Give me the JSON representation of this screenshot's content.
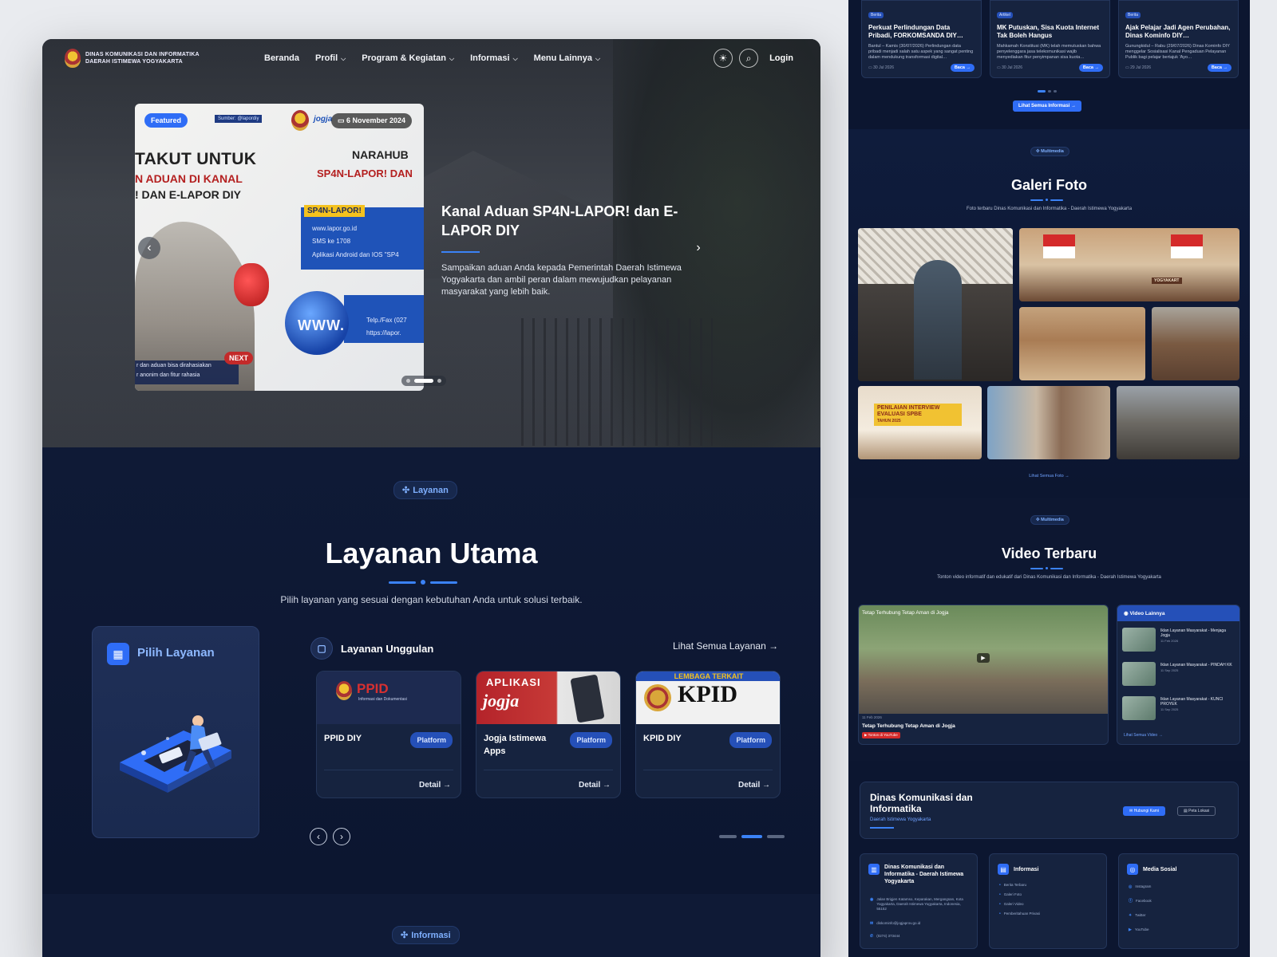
{
  "nav": {
    "logo_line1": "DINAS KOMUNIKASI DAN INFORMATIKA",
    "logo_line2": "DAERAH ISTIMEWA YOGYAKARTA",
    "items": [
      "Beranda",
      "Profil",
      "Program & Kegiatan",
      "Informasi",
      "Menu Lainnya"
    ],
    "login": "Login"
  },
  "hero": {
    "featured": "Featured",
    "sumber": "Sumber: @lapordiy",
    "logo_text": "jogja",
    "date": "6 November 2024",
    "poster_line1": "TAKUT UNTUK",
    "poster_line2": "N ADUAN DI KANAL",
    "poster_line3": "!  DAN E-LAPOR DIY",
    "poster_right1": "NARAHUB",
    "poster_right2": "SP4N-LAPOR!  DAN",
    "poster_tag": "SP4N-LAPOR!",
    "poster_item1": "www.lapor.go.id",
    "poster_item2": "SMS ke 1708",
    "poster_item3": "Aplikasi Android dan IOS \"SP4",
    "poster_item4": "Telp./Fax (027",
    "poster_item5": "https://lapor.",
    "poster_globe": "WWW.",
    "poster_next": "NEXT",
    "poster_bottom1": "r dan aduan bisa dirahasiakan",
    "poster_bottom2": "r anonim dan fitur rahasia",
    "title": "Kanal Aduan SP4N-LAPOR! dan E-LAPOR DIY",
    "desc": "Sampaikan aduan Anda kepada Pemerintah Daerah Istimewa Yogyakarta dan ambil peran dalam mewujudkan pelayanan masyarakat yang lebih baik."
  },
  "layanan": {
    "pill": "Layanan",
    "title": "Layanan Utama",
    "subtitle": "Pilih layanan yang sesuai dengan kebutuhan Anda untuk solusi terbaik.",
    "pilih": "Pilih Layanan",
    "unggulan": "Layanan Unggulan",
    "lihat_semua": "Lihat Semua Layanan",
    "cards": [
      {
        "name": "PPID DIY",
        "badge": "Platform",
        "detail": "Detail",
        "img_text": "PPID",
        "img_sub": "Informasi dan Dokumentasi"
      },
      {
        "name": "Jogja Istimewa Apps",
        "badge": "Platform",
        "detail": "Detail",
        "img_text": "APLIKASI",
        "img_sub": "jogja"
      },
      {
        "name": "KPID DIY",
        "badge": "Platform",
        "detail": "Detail",
        "img_text": "KPID",
        "img_sub": "LEMBAGA TERKAIT"
      }
    ]
  },
  "informasi": {
    "pill": "Informasi"
  },
  "news": [
    {
      "cat": "Berita",
      "title": "Perkuat Perlindungan Data Pribadi, FORKOMSANDA DIY…",
      "desc": "Bantul – Kamis (30/07/2026) Perlindungan data pribadi menjadi salah satu aspek yang sangat penting dalam mendukung transformasi digital…",
      "date": "30 Jul 2026",
      "btn": "Baca"
    },
    {
      "cat": "Artikel",
      "title": "MK Putuskan, Sisa Kuota Internet Tak Boleh Hangus",
      "desc": "Mahkamah Konstitusi (MK) telah memutuskan bahwa penyelenggara jasa telekomunikasi wajib menyediakan fitur penyimpanan sisa kuota…",
      "date": "30 Jul 2026",
      "btn": "Baca"
    },
    {
      "cat": "Berita",
      "title": "Ajak Pelajar Jadi Agen Perubahan, Dinas Kominfo DIY…",
      "desc": "Gunungkidul – Rabu (29/07/2026) Dinas Kominfo DIY menggelar Sosialisasi Kanal Pengaduan Pelayanan Publik bagi pelajar bertajuk 'Ayo…",
      "date": "29 Jul 2026",
      "btn": "Baca"
    }
  ],
  "news_all": "Lihat Semua Informasi",
  "galeri": {
    "pill": "Multimedia",
    "title": "Galeri Foto",
    "subtitle": "Foto terbaru Dinas Komunikasi dan Informatika - Daerah Istimewa Yogyakarta",
    "photo_caption1": "YOGYAKART",
    "photo_caption2": "PENILAIAN INTERVIEW EVALUASI SPBE",
    "photo_caption3": "TAHUN 2025",
    "link": "Lihat Semua Foto"
  },
  "video": {
    "pill": "Multimedia",
    "title": "Video Terbaru",
    "subtitle": "Tonton video informatif dan edukatif dari Dinas Komunikasi dan Informatika - Daerah Istimewa Yogyakarta",
    "main_caption": "Tetap Terhubung Tetap Aman di Jogja",
    "main_date": "11 Feb 2026",
    "main_title": "Tetap Terhubung Tetap Aman di Jogja",
    "yt": "Tonton di YouTube",
    "side_header": "Video Lainnya",
    "side_items": [
      {
        "title": "Iklan Layanan Masyarakat - Menjaga Jogja",
        "date": "11 Feb 2026"
      },
      {
        "title": "Iklan Layanan Masyarakat - PINDAH KK",
        "date": "11 Sep 2025"
      },
      {
        "title": "Iklan Layanan Masyarakat - KUNCI PROYEK",
        "date": "11 Sep 2025"
      }
    ],
    "side_more": "Lihat Semua Video"
  },
  "contact": {
    "title": "Dinas Komunikasi dan Informatika",
    "sub": "Daerah Istimewa Yogyakarta",
    "btn1": "Hubungi Kami",
    "btn2": "Peta Lokasi"
  },
  "footer": {
    "col1_title": "Dinas Komunikasi dan Informatika - Daerah Istimewa Yogyakarta",
    "col1_address": "Jalan Brigjen Katamso, Keparakan, Mergangsan, Kota Yogyakarta, Daerah Istimewa Yogyakarta, Indonesia, 55152",
    "col1_email": "diskominfo@jogjaprov.go.id",
    "col1_phone": "(0274) 373444",
    "col2_title": "Informasi",
    "col2_links": [
      "Berita Terbaru",
      "Galeri Foto",
      "Galeri Video",
      "Pemberitahuan Privasi"
    ],
    "col3_title": "Media Sosial",
    "col3_links": [
      "Instagram",
      "Facebook",
      "Twitter",
      "YouTube"
    ]
  }
}
